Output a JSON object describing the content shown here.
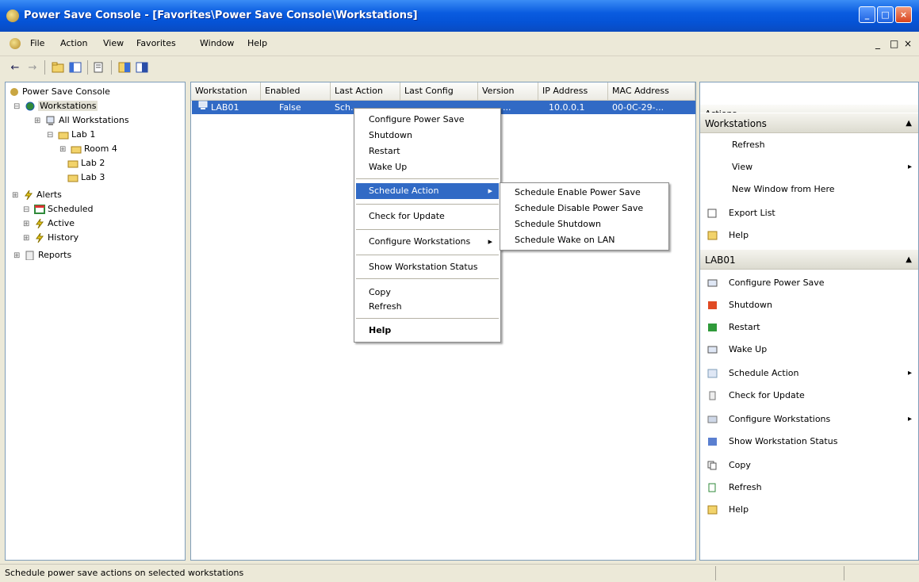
{
  "window": {
    "title": "Power Save Console - [Favorites\\Power Save Console\\Workstations]",
    "min": "_",
    "max": "□",
    "close": "×"
  },
  "menubar": {
    "items": [
      "File",
      "Action",
      "View",
      "Favorites",
      "Window",
      "Help"
    ],
    "mdi": [
      "_",
      "□",
      "×"
    ]
  },
  "toolbar": {
    "back": "←",
    "forward": "→"
  },
  "tree": {
    "root": "Power Save Console",
    "workstations": "Workstations",
    "all_workstations": "All Workstations",
    "lab_1": "Lab 1",
    "room_4": "Room 4",
    "lab_2": "Lab 2",
    "lab_3": "Lab 3",
    "alerts": "Alerts",
    "scheduled": "Scheduled",
    "active": "Active",
    "history": "History",
    "reports": "Reports"
  },
  "list": {
    "columns": [
      "Workstation",
      "Enabled",
      "Last Action",
      "Last Config",
      "Version",
      "IP Address",
      "MAC Address"
    ],
    "row": {
      "workstation": "LAB01",
      "enabled": "False",
      "last_action": "Sch...",
      "version": "...",
      "ip": "10.0.0.1",
      "mac": "00-0C-29-..."
    }
  },
  "context_menu": {
    "items": [
      "Configure Power Save",
      "Shutdown",
      "Restart",
      "Wake Up",
      "Schedule Action",
      "Check for Update",
      "Configure Workstations",
      "Show Workstation Status",
      "Copy",
      "Refresh",
      "Help"
    ]
  },
  "submenu": {
    "items": [
      "Schedule Enable Power Save",
      "Schedule Disable Power Save",
      "Schedule Shutdown",
      "Schedule Wake on LAN"
    ]
  },
  "actions": {
    "header": "Actions",
    "section1": "Workstations",
    "s1_items": [
      "Refresh",
      "View",
      "New Window from Here",
      "Export List",
      "Help"
    ],
    "section2": "LAB01",
    "s2_items": [
      "Configure Power Save",
      "Shutdown",
      "Restart",
      "Wake Up",
      "Schedule Action",
      "Check for Update",
      "Configure Workstations",
      "Show Workstation Status",
      "Copy",
      "Refresh",
      "Help"
    ]
  },
  "status": {
    "text": "Schedule power save actions on selected workstations"
  }
}
